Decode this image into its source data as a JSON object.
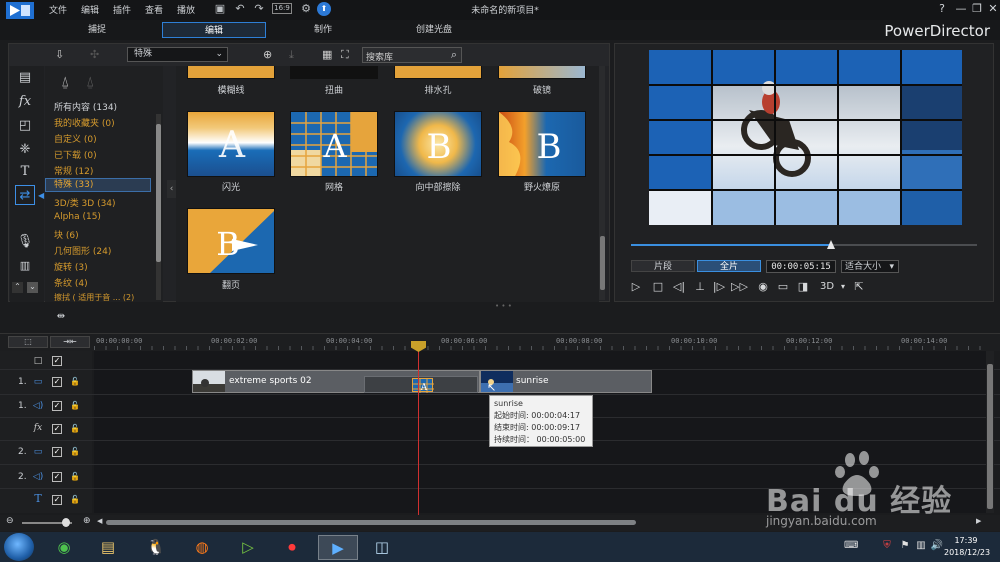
{
  "menu": [
    "文件",
    "编辑",
    "插件",
    "查看",
    "播放"
  ],
  "document_title": "未命名的新项目*",
  "app_name": "PowerDirector",
  "window_buttons": [
    "?",
    "—",
    "❐",
    "✕"
  ],
  "modes": [
    "捕捉",
    "编辑",
    "制作",
    "创建光盘"
  ],
  "active_mode": "编辑",
  "toolbar": {
    "category_dropdown": "特殊",
    "search_placeholder": "搜索库"
  },
  "categories": [
    {
      "label": "所有内容 (134)"
    },
    {
      "label": "我的收藏夹  (0)"
    },
    {
      "label": "自定义  (0)"
    },
    {
      "label": "已下载  (0)"
    },
    {
      "label": "常规  (12)"
    },
    {
      "label": "特殊  (33)"
    },
    {
      "label": "3D/类 3D  (34)"
    },
    {
      "label": "Alpha  (15)"
    },
    {
      "label": "块  (6)"
    },
    {
      "label": "几何图形  (24)"
    },
    {
      "label": "旋转  (3)"
    },
    {
      "label": "条纹  (4)"
    },
    {
      "label": "擦拭 ( 适用于音 ...  (2)"
    }
  ],
  "active_category": "特殊  (33)",
  "transitions_top_row": [
    "模糊线",
    "扭曲",
    "排水孔",
    "破镜"
  ],
  "transitions": [
    {
      "label": "闪光",
      "letter": "A"
    },
    {
      "label": "网格",
      "letter": "A"
    },
    {
      "label": "向中部擦除",
      "letter": "B"
    },
    {
      "label": "野火燎原",
      "letter": "B"
    },
    {
      "label": "翻页",
      "letter": "B"
    }
  ],
  "preview": {
    "tab_clip": "片段",
    "tab_movie": "全片",
    "timecode": "00:00:05:15",
    "zoom": "适合大小",
    "mode_3d": "3D",
    "scrub_position": 0.58
  },
  "timeline": {
    "ruler": [
      "00:00:00:00",
      "00:00:02:00",
      "00:00:04:00",
      "00:00:06:00",
      "00:00:08:00",
      "00:00:10:00",
      "00:00:12:00",
      "00:00:14:00"
    ],
    "tracks": [
      {
        "num": "1.",
        "type": "video"
      },
      {
        "num": "1.",
        "type": "audio"
      },
      {
        "num": "",
        "type": "fx"
      },
      {
        "num": "2.",
        "type": "video"
      },
      {
        "num": "2.",
        "type": "audio"
      },
      {
        "num": "",
        "type": "title"
      }
    ],
    "clip1": "extreme sports 02",
    "clip2": "sunrise",
    "tooltip": {
      "title": "sunrise",
      "start": "起始时间: 00:00:04:17",
      "end": "结束时间: 00:00:09:17",
      "duration": "持续时间：  00:00:05:00"
    }
  },
  "taskbar": {
    "time": "17:39",
    "date": "2018/12/23"
  },
  "watermark": {
    "brand": "Bai du 经验",
    "url": "jingyan.baidu.com"
  },
  "colors": {
    "accent": "#2e7fd6",
    "category": "#d59a2d",
    "playhead": "#d03030"
  }
}
